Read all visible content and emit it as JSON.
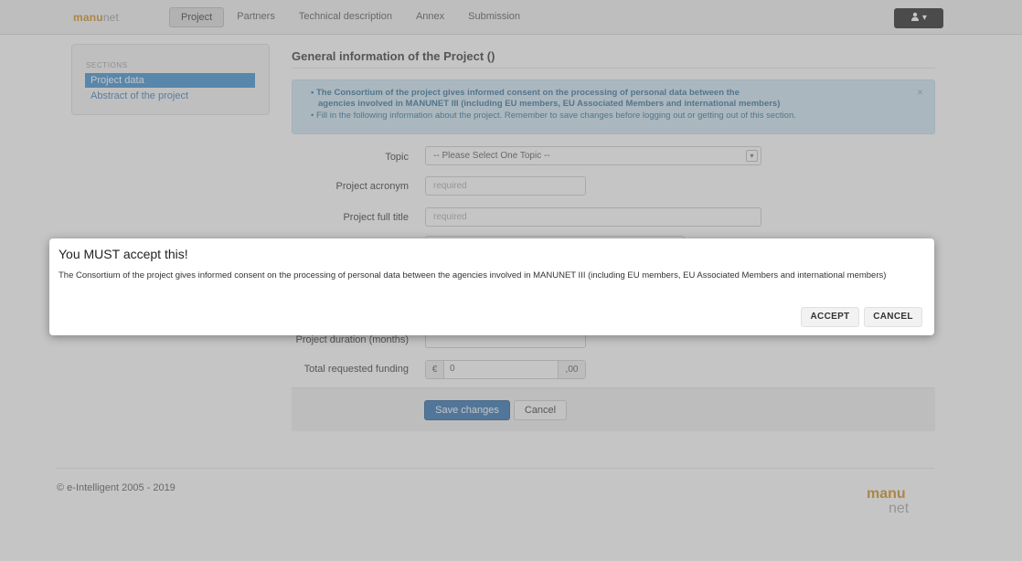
{
  "navbar": {
    "brand_main": "manu",
    "brand_suffix": "net",
    "items": [
      {
        "label": "Project",
        "active": true
      },
      {
        "label": "Partners",
        "active": false
      },
      {
        "label": "Technical description",
        "active": false
      },
      {
        "label": "Annex",
        "active": false
      },
      {
        "label": "Submission",
        "active": false
      }
    ],
    "user_icon": "user-icon",
    "user_caret": "▾"
  },
  "sidebar": {
    "title": "SECTIONS",
    "items": [
      {
        "label": "Project data",
        "active": true
      },
      {
        "label": "Abstract of the project",
        "active": false
      }
    ]
  },
  "main": {
    "title": "General information of the Project ()",
    "alert": {
      "line1": "• The Consortium of the project gives informed consent on the processing of personal data between the",
      "line2": "agencies involved in MANUNET III (including EU members, EU Associated Members and international members)",
      "line3": "• Fill in the following information about the project. Remember to save changes before logging out or getting out of this section.",
      "close": "×"
    },
    "form": {
      "topic_label": "Topic",
      "topic_value": "-- Please Select One Topic --",
      "acronym_label": "Project acronym",
      "acronym_placeholder": "required",
      "title_label": "Project full title",
      "title_placeholder": "required",
      "duration_label": "Project duration (months)",
      "funding_label": "Total requested funding",
      "funding_currency": "€",
      "funding_value": "0",
      "funding_decimals": ",00"
    },
    "buttons": {
      "save": "Save changes",
      "cancel": "Cancel"
    }
  },
  "footer": {
    "copyright": "© e-Intelligent 2005 - 2019",
    "logo_main": "manu",
    "logo_suffix": "net"
  },
  "modal": {
    "title": "You MUST accept this!",
    "body": "The Consortium of the project gives informed consent on the processing of personal data between the agencies involved in MANUNET III (including EU members, EU Associated Members and international members)",
    "accept": "ACCEPT",
    "cancel": "CANCEL"
  },
  "colors": {
    "overlay": "#7f7f7f",
    "primary": "#2d6fb0",
    "sidebar_active": "#3a8ed0",
    "alert_bg": "#cfe6f3",
    "brand": "#d08c1a"
  }
}
